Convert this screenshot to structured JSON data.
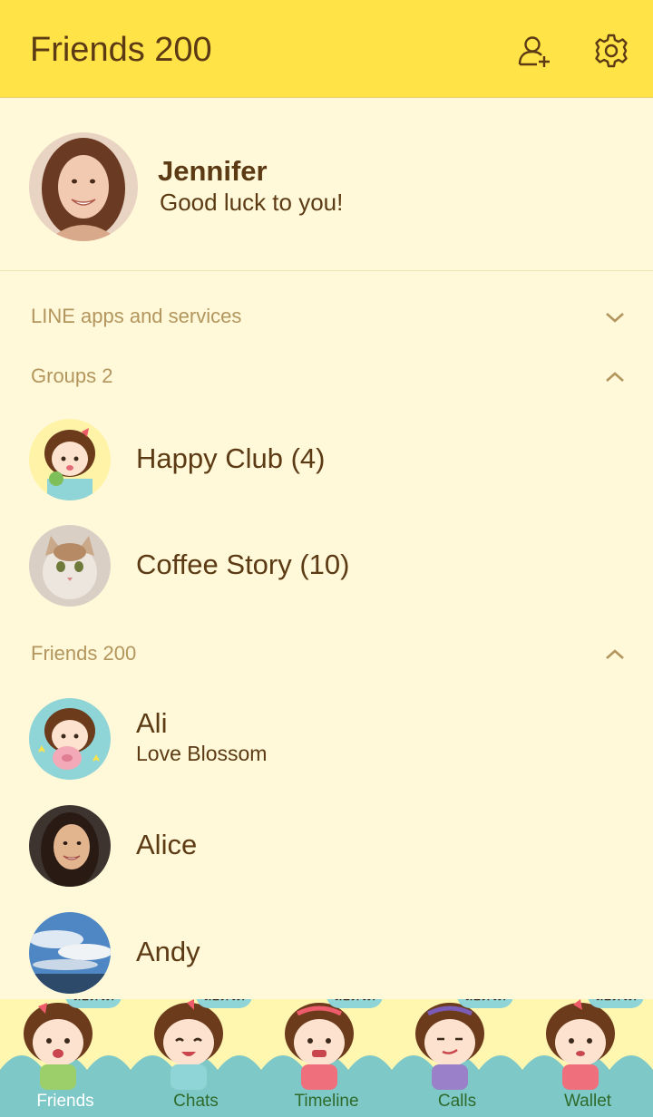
{
  "header": {
    "title": "Friends 200",
    "add_friend_icon": "add-friend-icon",
    "settings_icon": "gear-icon",
    "background": "#ffe347"
  },
  "profile": {
    "name": "Jennifer",
    "status": "Good luck to you!"
  },
  "sections": {
    "services": {
      "label": "LINE apps and services",
      "state": "collapsed"
    },
    "groups": {
      "label": "Groups 2",
      "state": "expanded"
    },
    "friends": {
      "label": "Friends 200",
      "state": "expanded"
    }
  },
  "groups": [
    {
      "name": "Happy Club (4)",
      "avatar": "cartoon-girl-avatar"
    },
    {
      "name": "Coffee Story (10)",
      "avatar": "cat-photo-avatar"
    }
  ],
  "friends": [
    {
      "name": "Ali",
      "status": "Love Blossom",
      "avatar": "cartoon-girl-pig-avatar"
    },
    {
      "name": "Alice",
      "status": "",
      "avatar": "woman-photo-avatar"
    },
    {
      "name": "Andy",
      "status": "",
      "avatar": "sky-photo-avatar"
    }
  ],
  "tabs": [
    {
      "label": "Friends",
      "badge": "ลอตโต้",
      "active": true
    },
    {
      "label": "Chats",
      "badge": "ลอตโต้",
      "active": false
    },
    {
      "label": "Timeline",
      "badge": "ลอตโต้",
      "active": false
    },
    {
      "label": "Calls",
      "badge": "ลอตโต้",
      "active": false
    },
    {
      "label": "Wallet",
      "badge": "ลอตโต้",
      "active": false
    }
  ],
  "colors": {
    "background": "#fff9d9",
    "text": "#5b3a14",
    "section": "#b3955e",
    "tab_wave": "#7ec9c8"
  }
}
